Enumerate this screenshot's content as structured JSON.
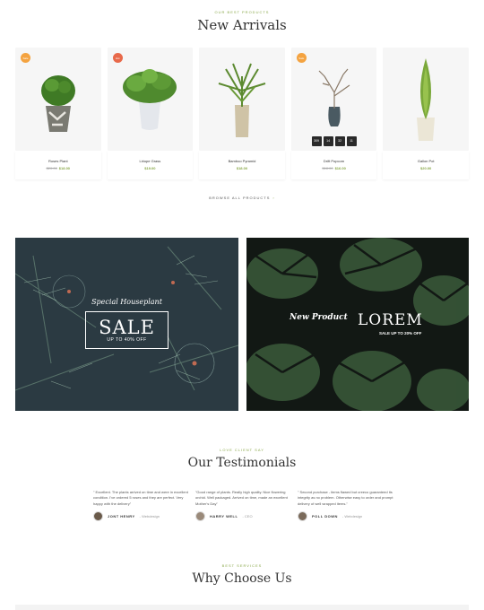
{
  "arrivals": {
    "eyebrow": "OUR BEST PRODUCTS",
    "title": "New Arrivals",
    "products": [
      {
        "name": "Roses Plant",
        "old_price": "$20.00",
        "price": "$18.00",
        "badge": "Sale",
        "badge_color": "#f4a340"
      },
      {
        "name": "Liriope Grass",
        "old_price": "",
        "price": "$19.00",
        "badge": "Hot",
        "badge_color": "#e8694a"
      },
      {
        "name": "Bamboo Pyramid",
        "old_price": "",
        "price": "$18.00",
        "badge": "",
        "badge_color": ""
      },
      {
        "name": "Drift Popcorn",
        "old_price": "$18.00",
        "price": "$16.00",
        "badge": "Sale",
        "badge_color": "#f4a340",
        "countdown": [
          "309",
          "14",
          "32",
          "11"
        ]
      },
      {
        "name": "Gallon Pot",
        "old_price": "",
        "price": "$20.00",
        "badge": "",
        "badge_color": ""
      }
    ],
    "browse_label": "BROWSE ALL PRODUCTS",
    "browse_icon": "chevron-right-icon"
  },
  "banners": {
    "left": {
      "script": "Special Houseplant",
      "headline": "SALE",
      "sub": "UP TO 40% OFF"
    },
    "right": {
      "script": "New Product",
      "headline": "LOREM",
      "sub": "SALE UP TO 20% OFF"
    }
  },
  "testimonials": {
    "eyebrow": "LOVE CLIENT SAY",
    "title": "Our Testimonials",
    "items": [
      {
        "quote": "\" Excellent. The plants arrived on time and were in excellent condition. I've ordered 5 roses and they are perfect. Very happy with the delivery\"",
        "name": "JONT HENRY",
        "role": "- Webdesign"
      },
      {
        "quote": "\"Good range of plants. Really high quality. Nice flowering orchid. Well packaged. Arrived on time, made an excellent Mother's Day\"",
        "name": "HARRY WELL",
        "role": "- CEO"
      },
      {
        "quote": "\" Second purchase - items flawed but creeco guaranteed its integrity as no problem. Otherwise easy to order and prompt delivery of well wrapped items.\"",
        "name": "POLL DOWN",
        "role": "- Webdesign"
      }
    ]
  },
  "why": {
    "eyebrow": "BEST SERVICES",
    "title": "Why Choose Us"
  },
  "colors": {
    "accent": "#8aa84a",
    "sale": "#f4a340",
    "hot": "#e8694a"
  }
}
